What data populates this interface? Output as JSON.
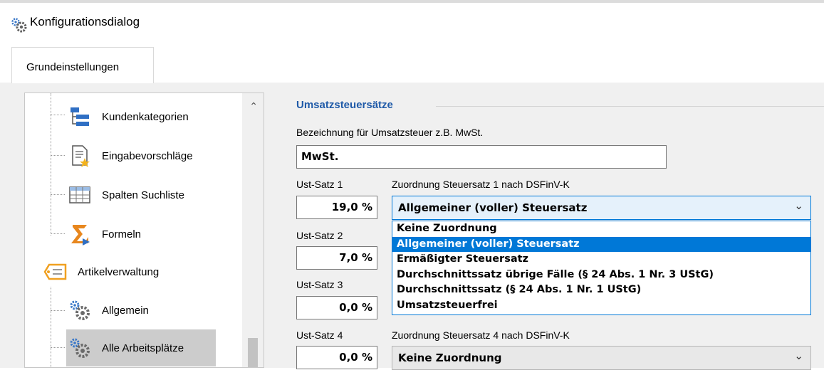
{
  "window": {
    "title": "Konfigurationsdialog",
    "icon": "gear-icon"
  },
  "tabs": [
    {
      "label": "Grundeinstellungen",
      "active": true
    }
  ],
  "tree": {
    "items": [
      {
        "label": "Kundenkategorien",
        "icon": "hierarchy-icon"
      },
      {
        "label": "Eingabevorschläge",
        "icon": "document-star-icon"
      },
      {
        "label": "Spalten Suchliste",
        "icon": "table-columns-icon"
      },
      {
        "label": "Formeln",
        "icon": "formula-icon"
      },
      {
        "label": "Artikelverwaltung",
        "icon": "tag-icon"
      },
      {
        "label": "Allgemein",
        "icon": "gears-icon"
      },
      {
        "label": "Alle Arbeitsplätze",
        "icon": "gears-icon",
        "selected": true
      }
    ]
  },
  "section": {
    "title": "Umsatzsteuersätze",
    "bezeichnung_label": "Bezeichnung für Umsatzsteuer z.B. MwSt.",
    "bezeichnung_value": "MwSt.",
    "rates": [
      {
        "label": "Ust-Satz 1",
        "value": "19,0 %",
        "mapping_label": "Zuordnung Steuersatz 1 nach DSFinV-K",
        "mapping_value": "Allgemeiner (voller) Steuersatz"
      },
      {
        "label": "Ust-Satz 2",
        "value": "7,0 %"
      },
      {
        "label": "Ust-Satz 3",
        "value": "0,0 %"
      },
      {
        "label": "Ust-Satz 4",
        "value": "0,0 %",
        "mapping_label": "Zuordnung Steuersatz 4 nach DSFinV-K",
        "mapping_value": "Keine Zuordnung"
      }
    ],
    "dropdown_options": [
      "Keine Zuordnung",
      "Allgemeiner (voller) Steuersatz",
      "Ermäßigter Steuersatz",
      "Durchschnittssatz übrige Fälle (§ 24 Abs. 1 Nr. 3 UStG)",
      "Durchschnittssatz (§ 24 Abs. 1 Nr. 1 UStG)",
      "Umsatzsteuerfrei"
    ],
    "dropdown_selected_index": 1
  },
  "colors": {
    "accent": "#0078d7",
    "section_title": "#1f5aa8",
    "selected_row": "#cccccc"
  }
}
